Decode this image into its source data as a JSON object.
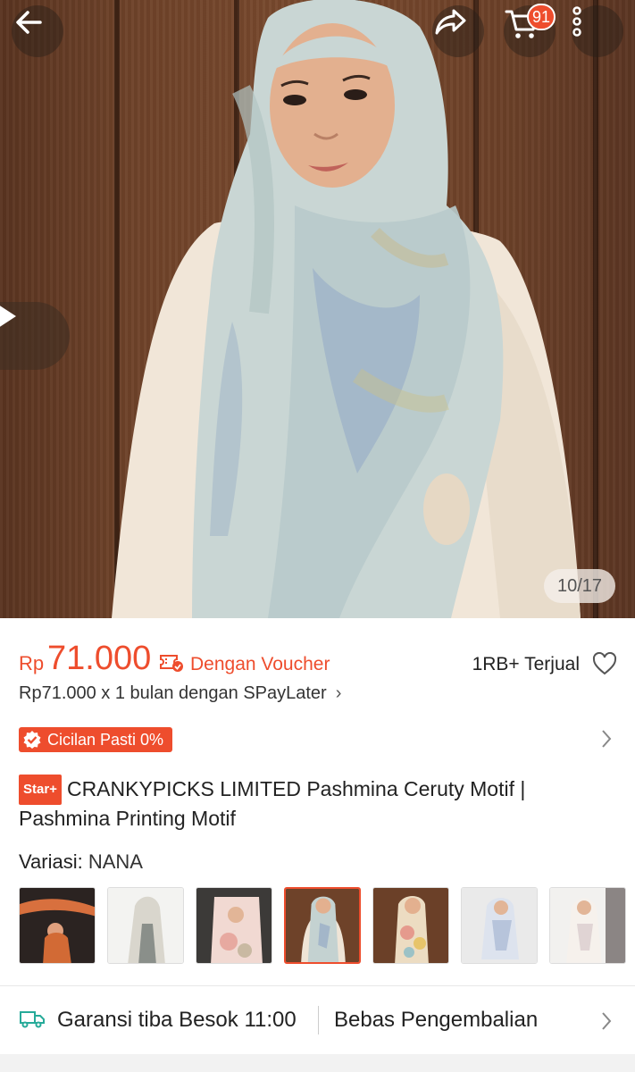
{
  "header": {
    "back_icon": "arrow-left-icon",
    "share_icon": "share-icon",
    "cart_icon": "cart-icon",
    "cart_count": "91",
    "more_icon": "more-vertical-icon"
  },
  "gallery": {
    "counter": "10/17",
    "play_icon": "play-icon"
  },
  "price": {
    "currency": "Rp",
    "value": "71.000",
    "voucher_label": "Dengan Voucher",
    "sold": "1RB+ Terjual",
    "installment": "Rp71.000 x 1 bulan dengan SPayLater",
    "installment_chevron": "›"
  },
  "cicilan": {
    "label": "Cicilan Pasti 0%"
  },
  "product": {
    "badge": "Star+",
    "title": "CRANKYPICKS LIMITED Pashmina Ceruty Motif | Pashmina Printing Motif"
  },
  "variants": {
    "label": "Variasi:",
    "selected": "NANA"
  },
  "shipping": {
    "guarantee": "Garansi tiba Besok 11:00",
    "returns": "Bebas Pengembalian"
  },
  "colors": {
    "accent": "#ee4d2d"
  }
}
